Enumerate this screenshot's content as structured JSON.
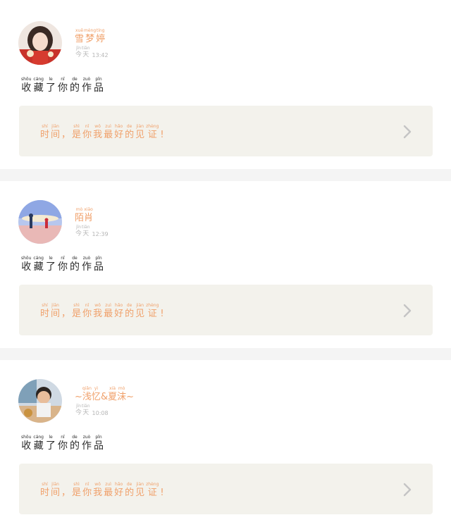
{
  "posts": [
    {
      "user": {
        "name_tokens": [
          {
            "hz": "雪",
            "py": "xuě"
          },
          {
            "hz": "梦",
            "py": "mèng"
          },
          {
            "hz": "婷",
            "py": "tíng"
          }
        ],
        "avatar_icon": "girl-portrait-avatar"
      },
      "meta": {
        "day_tokens": [
          {
            "hz": "今",
            "py": "jīn"
          },
          {
            "hz": "天",
            "py": "tiān"
          }
        ],
        "time": "13:42"
      },
      "action_tokens": [
        {
          "hz": "收",
          "py": "shōu"
        },
        {
          "hz": "藏",
          "py": "cáng"
        },
        {
          "hz": "了",
          "py": "le"
        },
        {
          "hz": "你",
          "py": "nǐ"
        },
        {
          "hz": "的",
          "py": "de"
        },
        {
          "hz": "作",
          "py": "zuò"
        },
        {
          "hz": "品",
          "py": "pǐn"
        }
      ],
      "quote_tokens": [
        {
          "hz": "时",
          "py": "shí"
        },
        {
          "hz": "间",
          "py": "jiān"
        },
        {
          "hz": "，",
          "py": ""
        },
        {
          "hz": "是",
          "py": "shì"
        },
        {
          "hz": "你",
          "py": "nǐ"
        },
        {
          "hz": "我",
          "py": "wǒ"
        },
        {
          "hz": "最",
          "py": "zuì"
        },
        {
          "hz": "好",
          "py": "hǎo"
        },
        {
          "hz": "的",
          "py": "de"
        },
        {
          "hz": "见",
          "py": "jiàn"
        },
        {
          "hz": "证",
          "py": "zhèng"
        },
        {
          "hz": "!",
          "py": ""
        }
      ],
      "chevron_icon": "chevron-right-icon"
    },
    {
      "user": {
        "name_tokens": [
          {
            "hz": "陌",
            "py": "mò"
          },
          {
            "hz": "肖",
            "py": "xiāo"
          }
        ],
        "avatar_icon": "beach-scene-avatar"
      },
      "meta": {
        "day_tokens": [
          {
            "hz": "今",
            "py": "jīn"
          },
          {
            "hz": "天",
            "py": "tiān"
          }
        ],
        "time": "12:39"
      },
      "action_tokens": [
        {
          "hz": "收",
          "py": "shōu"
        },
        {
          "hz": "藏",
          "py": "cáng"
        },
        {
          "hz": "了",
          "py": "le"
        },
        {
          "hz": "你",
          "py": "nǐ"
        },
        {
          "hz": "的",
          "py": "de"
        },
        {
          "hz": "作",
          "py": "zuò"
        },
        {
          "hz": "品",
          "py": "pǐn"
        }
      ],
      "quote_tokens": [
        {
          "hz": "时",
          "py": "shí"
        },
        {
          "hz": "间",
          "py": "jiān"
        },
        {
          "hz": "，",
          "py": ""
        },
        {
          "hz": "是",
          "py": "shì"
        },
        {
          "hz": "你",
          "py": "nǐ"
        },
        {
          "hz": "我",
          "py": "wǒ"
        },
        {
          "hz": "最",
          "py": "zuì"
        },
        {
          "hz": "好",
          "py": "hǎo"
        },
        {
          "hz": "的",
          "py": "de"
        },
        {
          "hz": "见",
          "py": "jiàn"
        },
        {
          "hz": "证",
          "py": "zhèng"
        },
        {
          "hz": "!",
          "py": ""
        }
      ],
      "chevron_icon": "chevron-right-icon"
    },
    {
      "user": {
        "name_tokens": [
          {
            "hz": "~",
            "py": ""
          },
          {
            "hz": "浅",
            "py": "qiǎn"
          },
          {
            "hz": "忆",
            "py": "yì"
          },
          {
            "hz": "&",
            "py": ""
          },
          {
            "hz": "夏",
            "py": "xià"
          },
          {
            "hz": "沫",
            "py": "mò"
          },
          {
            "hz": "~",
            "py": ""
          }
        ],
        "avatar_icon": "child-photo-avatar"
      },
      "meta": {
        "day_tokens": [
          {
            "hz": "今",
            "py": "jīn"
          },
          {
            "hz": "天",
            "py": "tiān"
          }
        ],
        "time": "10:08"
      },
      "action_tokens": [
        {
          "hz": "收",
          "py": "shōu"
        },
        {
          "hz": "藏",
          "py": "cáng"
        },
        {
          "hz": "了",
          "py": "le"
        },
        {
          "hz": "你",
          "py": "nǐ"
        },
        {
          "hz": "的",
          "py": "de"
        },
        {
          "hz": "作",
          "py": "zuò"
        },
        {
          "hz": "品",
          "py": "pǐn"
        }
      ],
      "quote_tokens": [
        {
          "hz": "时",
          "py": "shí"
        },
        {
          "hz": "间",
          "py": "jiān"
        },
        {
          "hz": "，",
          "py": ""
        },
        {
          "hz": "是",
          "py": "shì"
        },
        {
          "hz": "你",
          "py": "nǐ"
        },
        {
          "hz": "我",
          "py": "wǒ"
        },
        {
          "hz": "最",
          "py": "zuì"
        },
        {
          "hz": "好",
          "py": "hǎo"
        },
        {
          "hz": "的",
          "py": "de"
        },
        {
          "hz": "见",
          "py": "jiàn"
        },
        {
          "hz": "证",
          "py": "zhèng"
        },
        {
          "hz": "!",
          "py": ""
        }
      ],
      "chevron_icon": "chevron-right-icon"
    }
  ],
  "colors": {
    "accent_orange": "#f0a06a",
    "meta_gray": "#b5b5b5",
    "quote_bg": "#f3f2ec",
    "divider_bg": "#f4f4f4",
    "chevron_gray": "#c4c4c4"
  }
}
